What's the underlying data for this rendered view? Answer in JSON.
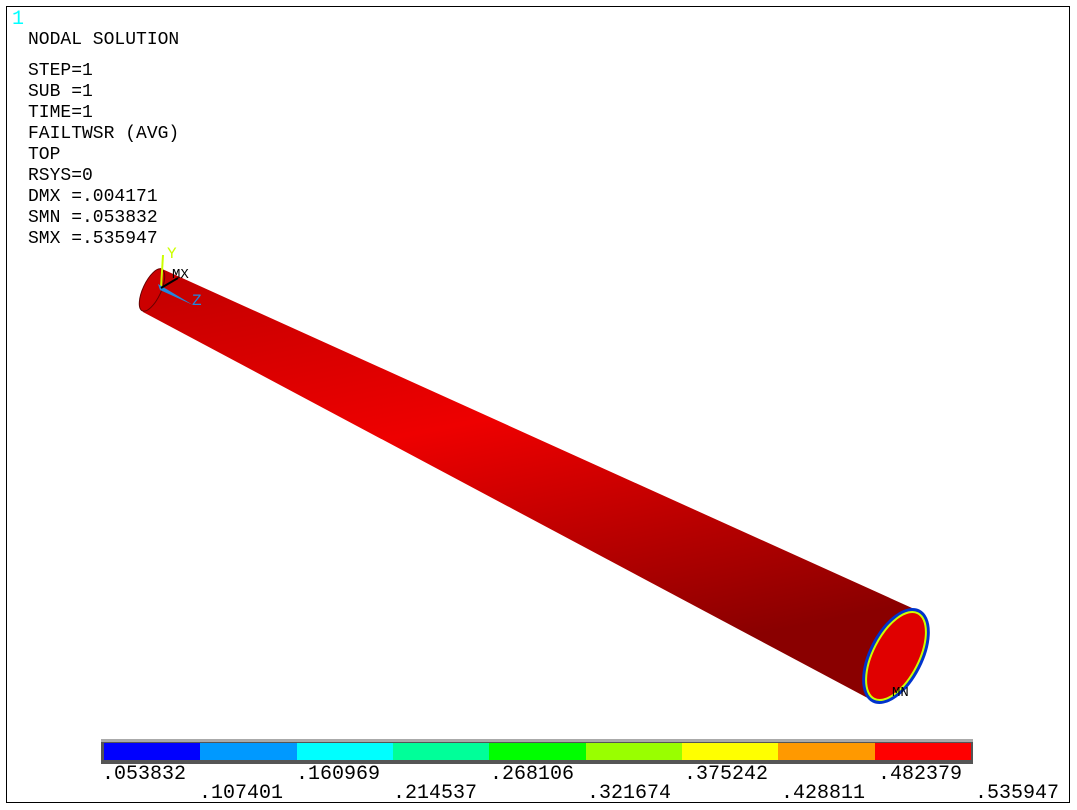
{
  "window_number": "1",
  "info": [
    "NODAL SOLUTION",
    "STEP=1",
    "SUB =1",
    "TIME=1",
    "FAILTWSR (AVG)",
    "TOP",
    "RSYS=0",
    "DMX =.004171",
    "SMN =.053832",
    "SMX =.535947"
  ],
  "markers": {
    "mx": "MX",
    "mn": "MN",
    "y": "Y",
    "z": "Z",
    "x": "X"
  },
  "legend": {
    "colors": [
      "#0000ff",
      "#0099ff",
      "#00ffff",
      "#00ff99",
      "#00ff00",
      "#99ff00",
      "#ffff00",
      "#ff9900",
      "#ff0000"
    ],
    "labels": [
      ".053832",
      ".107401",
      ".160969",
      ".214537",
      ".268106",
      ".321674",
      ".375242",
      ".428811",
      ".482379",
      ".535947"
    ]
  },
  "tube_color": "#e00000"
}
